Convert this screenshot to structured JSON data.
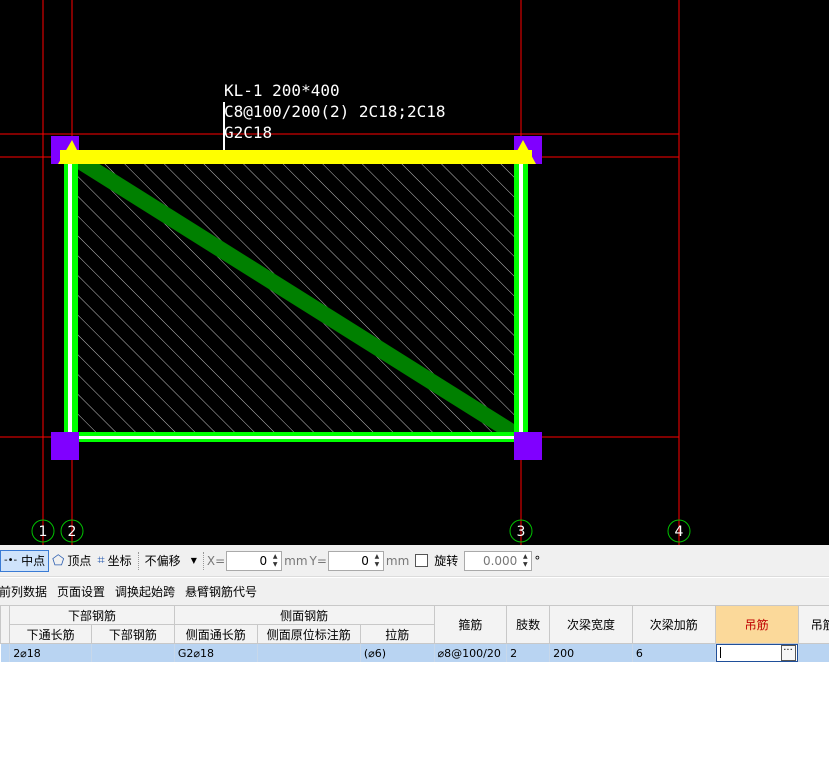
{
  "drawing": {
    "beam_label": {
      "line1": "KL-1 200*400",
      "line2": "C8@100/200(2) 2C18;2C18",
      "line3": "G2C18"
    },
    "axis_labels": [
      "1",
      "2",
      "3",
      "4"
    ],
    "colors": {
      "background": "#000000",
      "axis_line": "#ff0000",
      "grid_line": "#00c000",
      "column": "#8000ff",
      "beam_top": "#ffff00",
      "beam_side": "#00ff00",
      "diagonal": "#008000"
    }
  },
  "toolbar": {
    "midpoint": "中点",
    "vertex": "顶点",
    "coordinate": "坐标",
    "offset_mode": "不偏移",
    "x_label": "X=",
    "x_value": "0",
    "unit1": "mm",
    "y_label": "Y=",
    "y_value": "0",
    "unit2": "mm",
    "rotate_label": "旋转",
    "rotate_value": "0.000",
    "degree": "°"
  },
  "menu": {
    "items": [
      "前列数据",
      "页面设置",
      "调换起始跨",
      "悬臂钢筋代号"
    ]
  },
  "grid": {
    "group_headers": {
      "bottom_rebar": "下部钢筋",
      "side_rebar": "侧面钢筋"
    },
    "columns": {
      "bottom_continuous": "下通长筋",
      "bottom_rebar": "下部钢筋",
      "side_continuous": "侧面通长筋",
      "side_original": "侧面原位标注筋",
      "tie_bar": "拉筋",
      "stirrup": "箍筋",
      "legs": "肢数",
      "secondary_width": "次梁宽度",
      "secondary_extra": "次梁加筋",
      "hanger": "吊筋",
      "hanger_anchor": "吊筋锚"
    },
    "row": {
      "bottom_continuous": "2⌀18",
      "bottom_rebar": "",
      "side_continuous": "G2⌀18",
      "side_original": "",
      "tie_bar": "(⌀6)",
      "stirrup": "⌀8@100/20",
      "legs": "2",
      "secondary_width": "200",
      "secondary_extra": "6",
      "hanger": "",
      "hanger_anchor": ""
    }
  }
}
